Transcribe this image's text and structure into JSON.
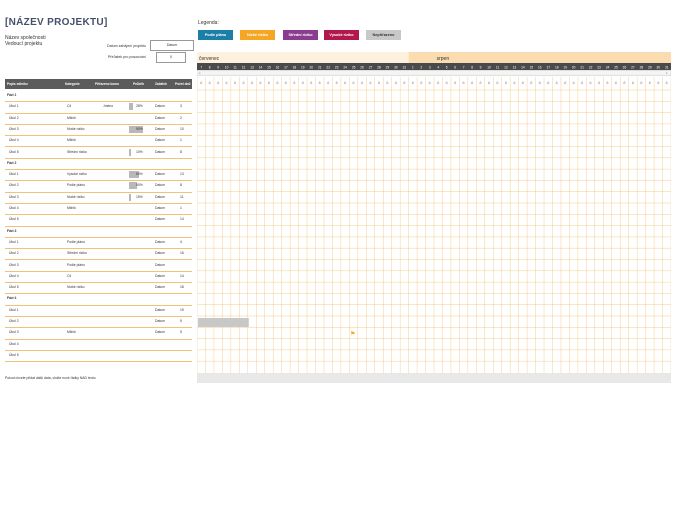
{
  "project": {
    "title": "[NÁZEV PROJEKTU]",
    "company": "Název společnosti",
    "manager": "Vedoucí projektu",
    "start_label": "Datum zahájení projektu",
    "start_value": "Datum",
    "scroll_label": "Přírůstek pro posouvání",
    "scroll_value": "0"
  },
  "legend": {
    "title": "Legenda:",
    "items": [
      {
        "label": "Podle plánu",
        "color": "#1b7fa7"
      },
      {
        "label": "Nízké riziko",
        "color": "#f5a623"
      },
      {
        "label": "Střední riziko",
        "color": "#8a3d8f"
      },
      {
        "label": "Vysoké riziko",
        "color": "#b3184b"
      },
      {
        "label": "Nepřiřazeno",
        "color": "#c8c8c8"
      }
    ]
  },
  "table": {
    "headers": [
      "Popis milníku",
      "Kategorie",
      "Přiřazeno komu",
      "Průběh",
      "Začátek",
      "Počet dnů"
    ],
    "rows": [
      {
        "type": "phase",
        "name": "Fázi 1"
      },
      {
        "type": "task",
        "name": "Úkol 1",
        "cat": "Cíl",
        "who": "Jméno",
        "prog": "28%",
        "start": "Datum",
        "days": "3",
        "pct": 0.28
      },
      {
        "type": "task",
        "name": "Úkol 2",
        "cat": "Milník",
        "who": "",
        "prog": "",
        "start": "Datum",
        "days": "2",
        "pct": 0
      },
      {
        "type": "task",
        "name": "Úkol 3",
        "cat": "Nízké riziko",
        "who": "",
        "prog": "90%",
        "start": "Datum",
        "days": "10",
        "pct": 0.9
      },
      {
        "type": "task",
        "name": "Úkol 4",
        "cat": "Milník",
        "who": "",
        "prog": "",
        "start": "Datum",
        "days": "1",
        "pct": 0
      },
      {
        "type": "task",
        "name": "Úkol 5",
        "cat": "Střední riziko",
        "who": "",
        "prog": "10%",
        "start": "Datum",
        "days": "8",
        "pct": 0.1
      },
      {
        "type": "phase",
        "name": "Fázi 2"
      },
      {
        "type": "task",
        "name": "Úkol 1",
        "cat": "Vysoké riziko",
        "who": "",
        "prog": "60%",
        "start": "Datum",
        "days": "13",
        "pct": 0.6
      },
      {
        "type": "task",
        "name": "Úkol 2",
        "cat": "Podle plánu",
        "who": "",
        "prog": "50%",
        "start": "Datum",
        "days": "8",
        "pct": 0.5
      },
      {
        "type": "task",
        "name": "Úkol 3",
        "cat": "Nízké riziko",
        "who": "",
        "prog": "15%",
        "start": "Datum",
        "days": "11",
        "pct": 0.15
      },
      {
        "type": "task",
        "name": "Úkol 4",
        "cat": "Milník",
        "who": "",
        "prog": "",
        "start": "Datum",
        "days": "1",
        "pct": 0
      },
      {
        "type": "task",
        "name": "Úkol 5",
        "cat": "",
        "who": "",
        "prog": "",
        "start": "Datum",
        "days": "14",
        "pct": 0
      },
      {
        "type": "phase",
        "name": "Fázi 3"
      },
      {
        "type": "task",
        "name": "Úkol 1",
        "cat": "Podle plánu",
        "who": "",
        "prog": "",
        "start": "Datum",
        "days": "4",
        "pct": 0
      },
      {
        "type": "task",
        "name": "Úkol 2",
        "cat": "Střední riziko",
        "who": "",
        "prog": "",
        "start": "Datum",
        "days": "16",
        "pct": 0
      },
      {
        "type": "task",
        "name": "Úkol 3",
        "cat": "Podle plánu",
        "who": "",
        "prog": "",
        "start": "Datum",
        "days": "",
        "pct": 0
      },
      {
        "type": "task",
        "name": "Úkol 4",
        "cat": "Cíl",
        "who": "",
        "prog": "",
        "start": "Datum",
        "days": "14",
        "pct": 0
      },
      {
        "type": "task",
        "name": "Úkol 5",
        "cat": "Nízké riziko",
        "who": "",
        "prog": "",
        "start": "Datum",
        "days": "18",
        "pct": 0
      },
      {
        "type": "phase",
        "name": "Fázi 4"
      },
      {
        "type": "task",
        "name": "Úkol 1",
        "cat": "",
        "who": "",
        "prog": "",
        "start": "Datum",
        "days": "19",
        "pct": 0
      },
      {
        "type": "task",
        "name": "Úkol 2",
        "cat": "",
        "who": "",
        "prog": "",
        "start": "Datum",
        "days": "5",
        "pct": 0
      },
      {
        "type": "task",
        "name": "Úkol 3",
        "cat": "Milník",
        "who": "",
        "prog": "",
        "start": "Datum",
        "days": "5",
        "pct": 0
      },
      {
        "type": "task",
        "name": "Úkol 4",
        "cat": "",
        "who": "",
        "prog": "",
        "start": "",
        "days": "",
        "pct": 0
      },
      {
        "type": "task",
        "name": "Úkol 5",
        "cat": "",
        "who": "",
        "prog": "",
        "start": "",
        "days": "",
        "pct": 0
      }
    ]
  },
  "timeline": {
    "months": [
      "červenec",
      "srpen"
    ],
    "july_days": [
      "7",
      "8",
      "9",
      "10",
      "11",
      "12",
      "13",
      "14",
      "15",
      "16",
      "17",
      "18",
      "19",
      "20",
      "21",
      "22",
      "23",
      "24",
      "25",
      "26",
      "27",
      "28",
      "29",
      "30",
      "31"
    ],
    "aug_days": [
      "1",
      "2",
      "3",
      "4",
      "5",
      "6",
      "7",
      "8",
      "9",
      "10",
      "11",
      "12",
      "13",
      "14",
      "15",
      "16",
      "17",
      "18",
      "19",
      "20",
      "21",
      "22",
      "23",
      "24",
      "25",
      "26",
      "27",
      "28",
      "29",
      "30",
      "31"
    ],
    "weekday": "Č"
  },
  "footer": "Pokud chcete přidat další data, vložte nové řádky NAD tento."
}
